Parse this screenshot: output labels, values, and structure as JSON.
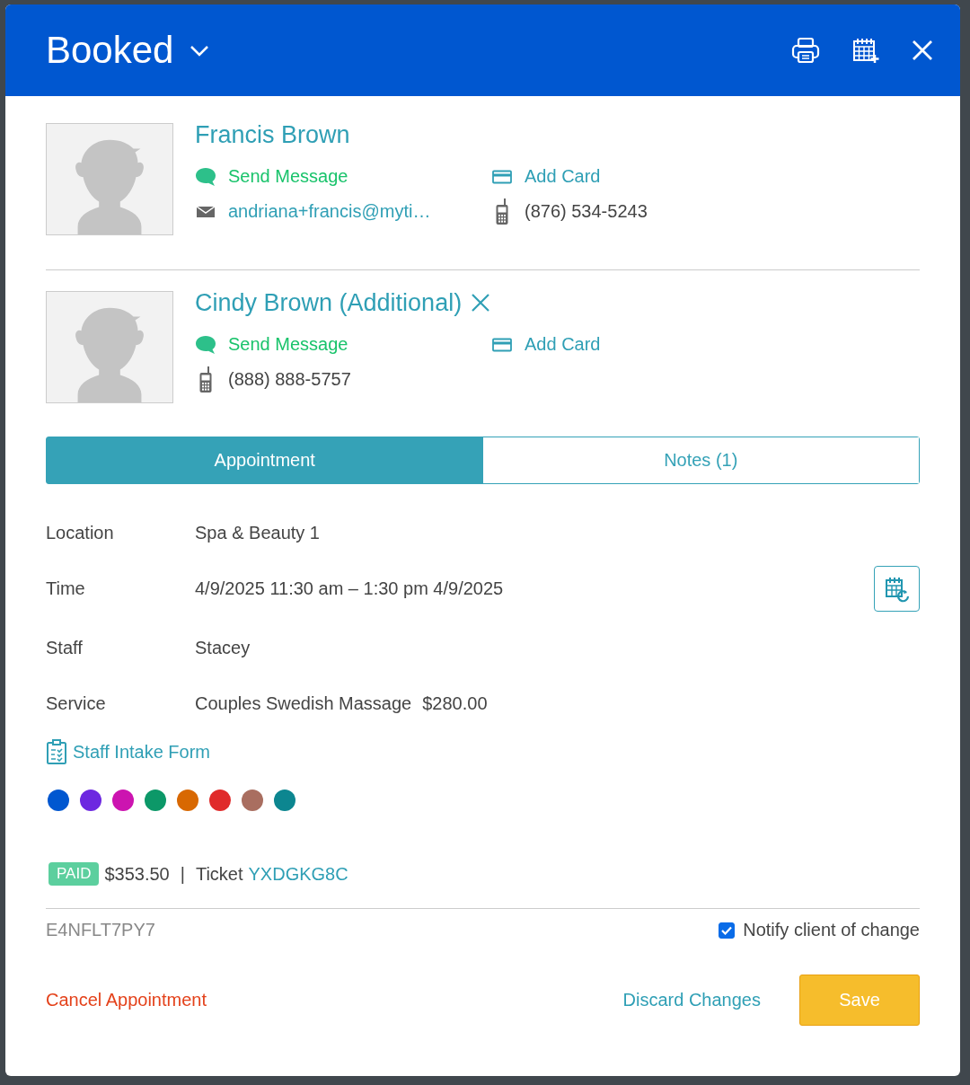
{
  "header": {
    "title": "Booked"
  },
  "clients": [
    {
      "name": "Francis Brown",
      "removable": false,
      "send_message": "Send Message",
      "add_card": "Add Card",
      "email": "andriana+francis@myti…",
      "phone": "(876) 534-5243"
    },
    {
      "name": "Cindy Brown (Additional)",
      "removable": true,
      "send_message": "Send Message",
      "add_card": "Add Card",
      "phone": "(888) 888-5757"
    }
  ],
  "tabs": [
    {
      "label": "Appointment",
      "selected": true
    },
    {
      "label": "Notes (1)",
      "selected": false
    }
  ],
  "details": [
    {
      "kind": "text",
      "label": "Location",
      "value": "Spa & Beauty 1"
    },
    {
      "kind": "reschedule",
      "label": "Time",
      "value": "4/9/2025 11:30 am – 1:30 pm 4/9/2025"
    },
    {
      "kind": "text",
      "label": "Staff",
      "value": "Stacey"
    },
    {
      "kind": "priced",
      "label": "Service",
      "value": "Couples Swedish Massage",
      "price": "$280.00"
    }
  ],
  "intake_form": "Staff Intake Form",
  "colors": [
    {
      "color": "#0057d0",
      "selected": false
    },
    {
      "color": "#6d28e0",
      "selected": false
    },
    {
      "color": "#cc14b0",
      "selected": false
    },
    {
      "color": "#0c9868",
      "selected": false
    },
    {
      "color": "#d86802",
      "selected": false
    },
    {
      "color": "#e02b2b",
      "selected": false
    },
    {
      "color": "#a96e60",
      "selected": false
    },
    {
      "color": "#0c8690",
      "selected": false
    }
  ],
  "payment": {
    "status": "PAID",
    "amount": "$353.50",
    "separator": "|",
    "ticket_label": "Ticket",
    "ticket": "YXDGKG8C"
  },
  "footer": {
    "code": "E4NFLT7PY7",
    "notify": {
      "label": "Notify client of change",
      "checked": true
    },
    "cancel": "Cancel Appointment",
    "discard": "Discard Changes",
    "save": "Save"
  }
}
